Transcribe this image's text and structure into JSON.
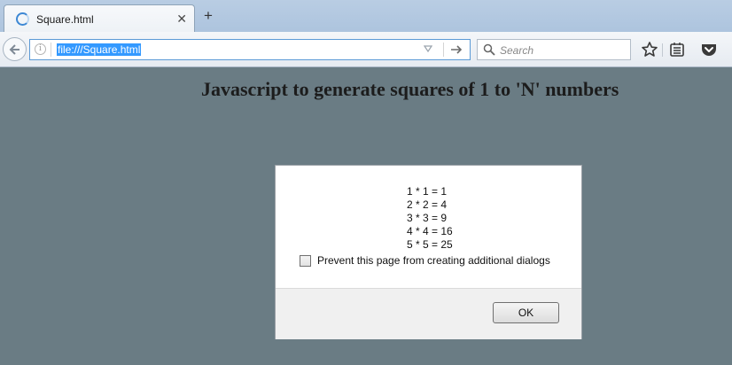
{
  "browser": {
    "tab": {
      "title": "Square.html",
      "close_glyph": "✕"
    },
    "new_tab_glyph": "+",
    "urlbar": {
      "url": "file:///Square.html"
    },
    "search": {
      "placeholder": "Search"
    },
    "icons": [
      "back-arrow-icon",
      "info-icon",
      "dropmarker-icon",
      "go-arrow-icon",
      "search-icon",
      "bookmark-star-icon",
      "reading-list-icon",
      "pocket-icon"
    ]
  },
  "page": {
    "heading": "Javascript to generate squares of 1 to 'N' numbers"
  },
  "dialog": {
    "message_lines": [
      "1 * 1 = 1",
      "2 * 2 = 4",
      "3 * 3 = 9",
      "4 * 4 = 16",
      "5 * 5 = 25"
    ],
    "prevent_label": "Prevent this page from creating additional dialogs",
    "prevent_checked": false,
    "ok_label": "OK"
  }
}
